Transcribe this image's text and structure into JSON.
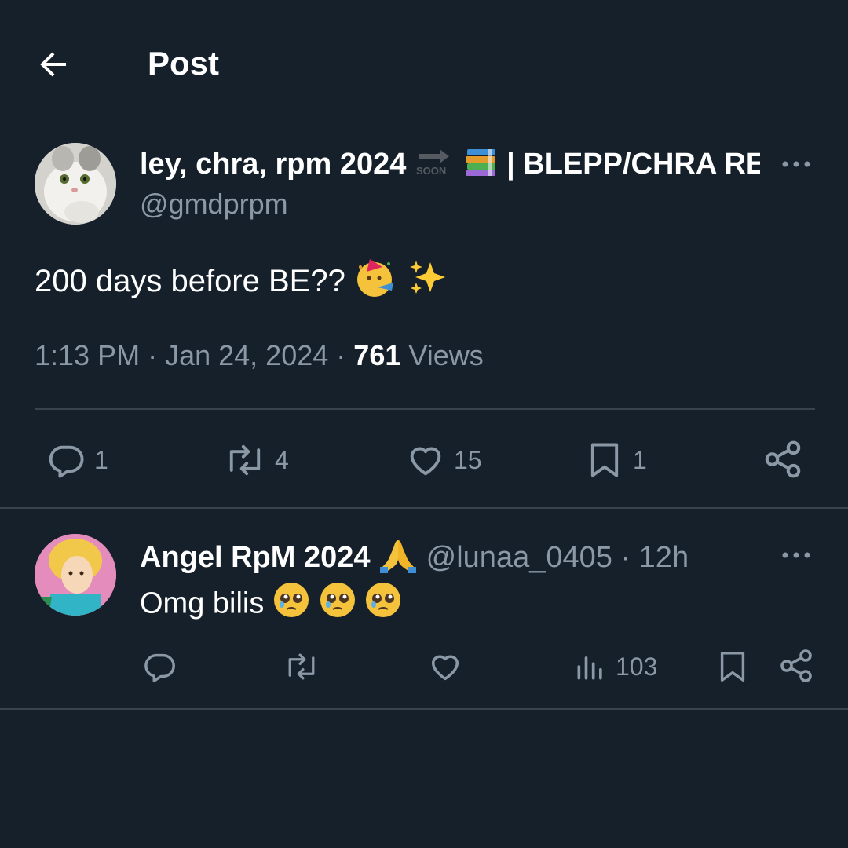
{
  "header": {
    "title": "Post",
    "back_icon": "back-arrow-icon"
  },
  "post": {
    "display_name": "ley, chra, rpm 2024",
    "name_suffix": "| BLEPP/CHRA RE",
    "name_emojis": [
      "soon-arrow-icon",
      "books-icon"
    ],
    "handle": "@gmdprpm",
    "text": "200 days before BE??",
    "text_emojis": [
      "partying-face-emoji",
      "sparkles-emoji"
    ],
    "time": "1:13 PM",
    "date": "Jan 24, 2024",
    "views_count": "761",
    "views_label": "Views",
    "actions": {
      "replies": "1",
      "reposts": "4",
      "likes": "15",
      "bookmarks": "1"
    }
  },
  "reply": {
    "display_name": "Angel RpM 2024",
    "name_emoji": "folded-hands-emoji",
    "handle": "@lunaa_0405",
    "age": "12h",
    "text": "Omg bilis",
    "text_emojis": [
      "pleading-face-emoji",
      "pleading-face-emoji",
      "pleading-face-emoji"
    ],
    "views": "103"
  },
  "colors": {
    "background": "#15202b",
    "text": "#ffffff",
    "muted": "#8b98a5",
    "divider": "#38444d"
  }
}
